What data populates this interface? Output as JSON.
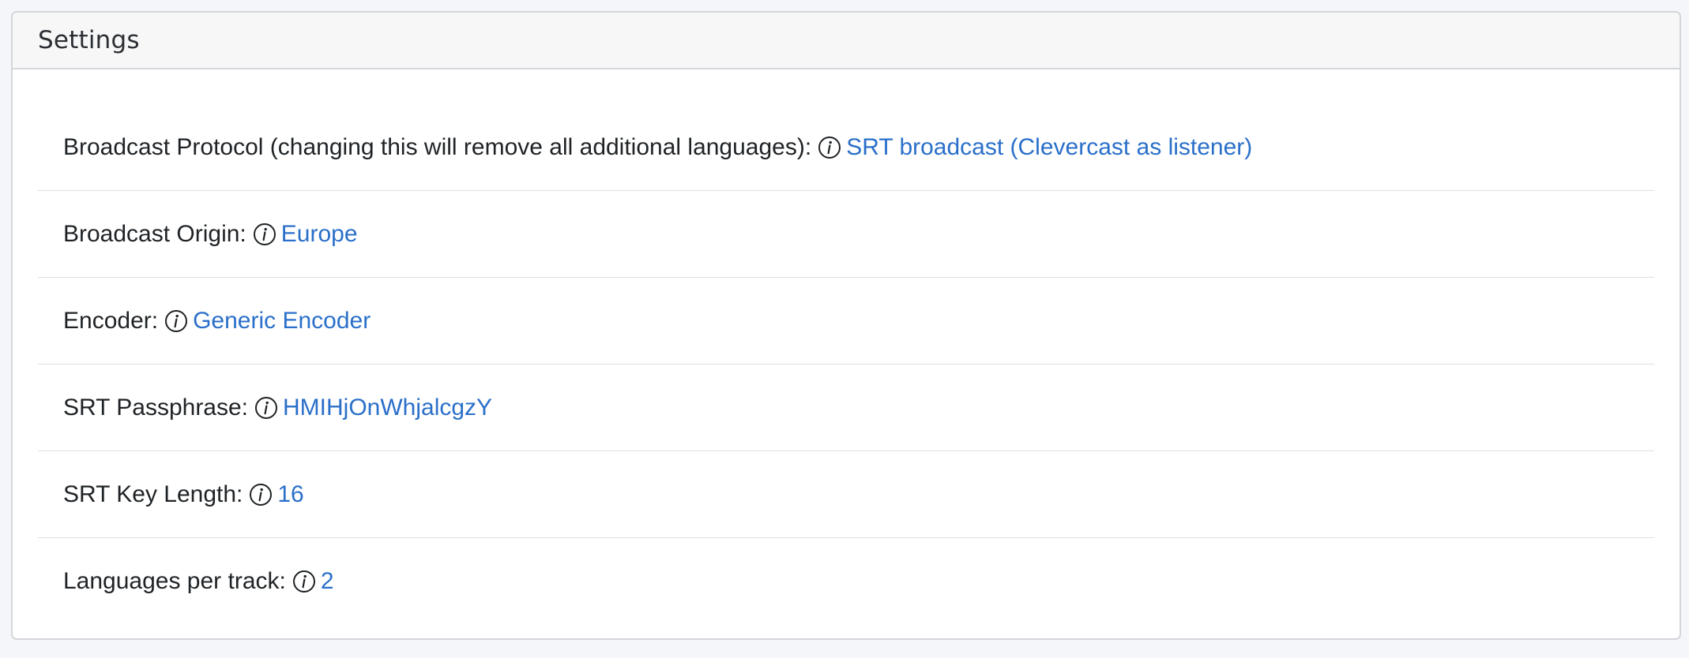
{
  "panel": {
    "title": "Settings"
  },
  "settings": [
    {
      "label": "Broadcast Protocol (changing this will remove all additional languages):",
      "value": "SRT broadcast (Clevercast as listener)"
    },
    {
      "label": "Broadcast Origin:",
      "value": "Europe"
    },
    {
      "label": "Encoder:",
      "value": "Generic Encoder"
    },
    {
      "label": "SRT Passphrase:",
      "value": "HMIHjOnWhjalcgzY"
    },
    {
      "label": "SRT Key Length:",
      "value": "16"
    },
    {
      "label": "Languages per track:",
      "value": "2"
    }
  ],
  "icons": {
    "info": "info-circle-icon"
  },
  "colors": {
    "link": "#2a6fc9",
    "text": "#1f2326",
    "header_bg": "#f7f7f7",
    "border": "#d3d6da",
    "page_bg": "#f4f6f9"
  }
}
